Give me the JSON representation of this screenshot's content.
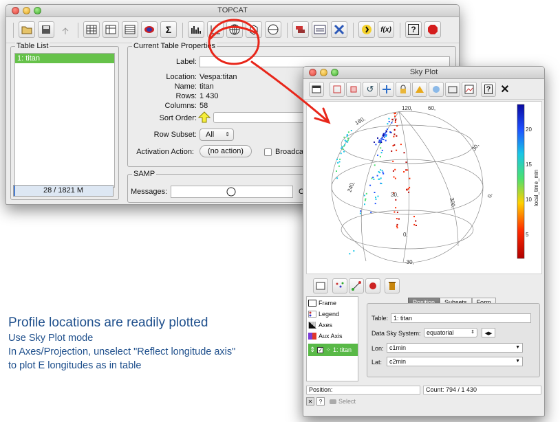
{
  "main_window": {
    "title": "TOPCAT",
    "table_list": {
      "title": "Table List",
      "items": [
        "1: titan"
      ]
    },
    "memory": {
      "label": "28 / 1821 M",
      "used_fraction": 0.0154
    },
    "properties": {
      "title": "Current Table Properties",
      "label_label": "Label:",
      "location_label": "Location:",
      "location_value": "Vespa:titan",
      "name_label": "Name:",
      "name_value": "titan",
      "rows_label": "Rows:",
      "rows_value": "1 430",
      "columns_label": "Columns:",
      "columns_value": "58",
      "sort_order_label": "Sort Order:",
      "row_subset_label": "Row Subset:",
      "row_subset_value": "All",
      "activation_label": "Activation Action:",
      "activation_value": "(no action)",
      "broadcast_label": "Broadcast"
    },
    "samp": {
      "title": "SAMP",
      "messages_label": "Messages:",
      "clients_label": "Cli"
    }
  },
  "sky_window": {
    "title": "Sky Plot",
    "legend_axis_label": "local_time_min",
    "colorbar_ticks": [
      "20",
      "15",
      "10",
      "5"
    ],
    "grid_labels": [
      "120,",
      "60,",
      "180,",
      "30,",
      "240,",
      "30,",
      "300,",
      "0,",
      "0,",
      "-30,"
    ],
    "layers": {
      "frame": "Frame",
      "legend": "Legend",
      "axes": "Axes",
      "aux_axis": "Aux Axis",
      "layer1": "1: titan"
    },
    "tabs": [
      "Position",
      "Subsets",
      "Form"
    ],
    "table_label": "Table:",
    "table_value": "1: titan",
    "sky_system_label": "Data Sky System:",
    "sky_system_value": "equatorial",
    "lon_label": "Lon:",
    "lon_value": "c1min",
    "lat_label": "Lat:",
    "lat_value": "c2min",
    "position_label": "Position:",
    "count_label": "Count: 794 / 1 430",
    "select_label": "Select"
  },
  "caption": {
    "heading": "Profile locations are readily plotted",
    "line1": "Use Sky Plot mode",
    "line2": "In Axes/Projection, unselect \"Reflect longitude axis\"",
    "line3": "to plot E longitudes as in table"
  },
  "colors": {
    "caption": "#1e4f8c",
    "selection_green": "#66c24a",
    "annotation_red": "#e8261a"
  }
}
